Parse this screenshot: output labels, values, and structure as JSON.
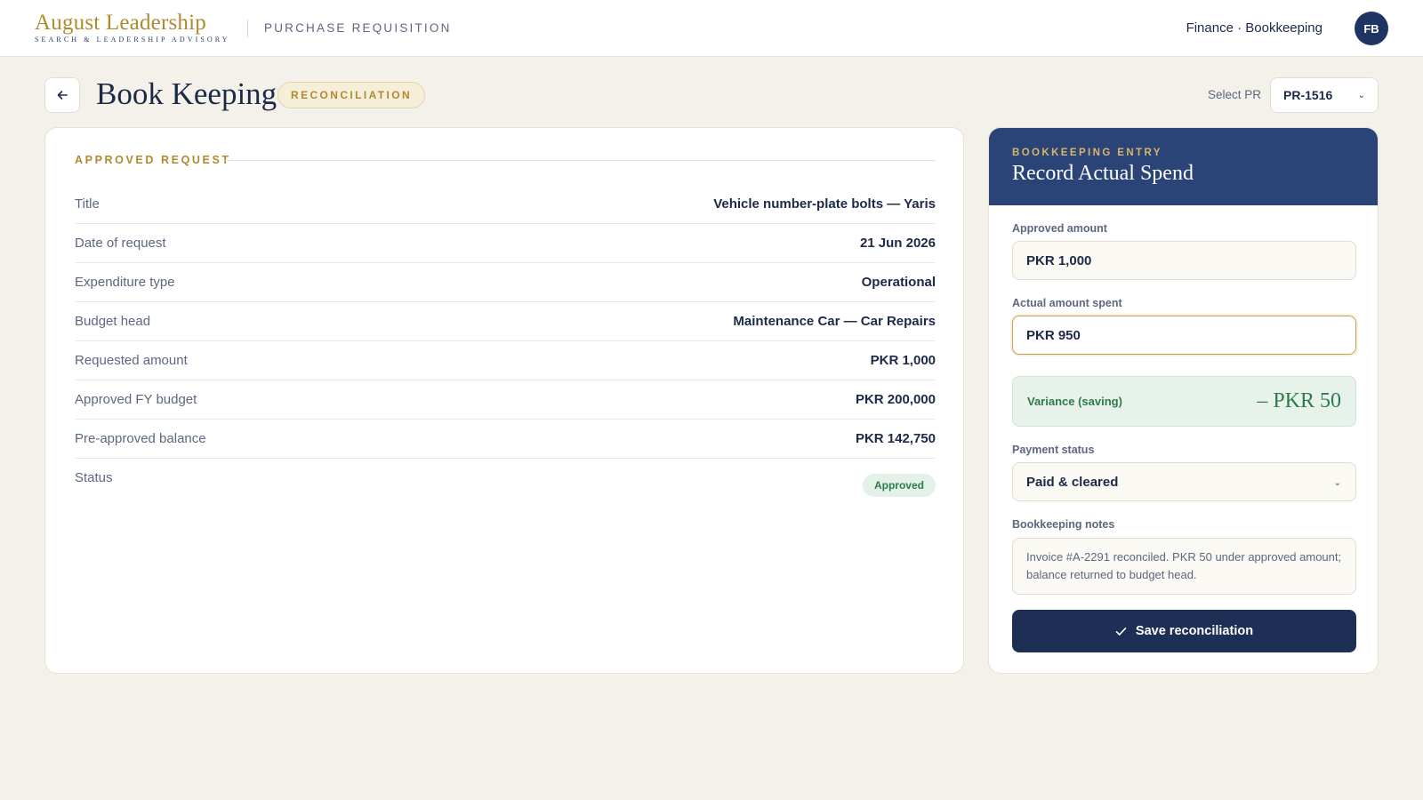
{
  "header": {
    "brand_name": "August Leadership",
    "brand_tagline": "SEARCH & LEADERSHIP ADVISORY",
    "module_title": "PURCHASE REQUISITION",
    "role_text": "Finance · Bookkeeping",
    "avatar_initials": "FB"
  },
  "page": {
    "title": "Book Keeping",
    "badge": "RECONCILIATION",
    "select_pr_label": "Select PR",
    "select_pr_value": "PR-1516"
  },
  "request": {
    "section_title": "APPROVED REQUEST",
    "rows": [
      {
        "label": "Title",
        "value": "Vehicle number-plate bolts — Yaris"
      },
      {
        "label": "Date of request",
        "value": "21 Jun 2026"
      },
      {
        "label": "Expenditure type",
        "value": "Operational"
      },
      {
        "label": "Budget head",
        "value": "Maintenance Car — Car Repairs"
      },
      {
        "label": "Requested amount",
        "value": "PKR 1,000"
      },
      {
        "label": "Approved FY budget",
        "value": "PKR 200,000"
      },
      {
        "label": "Pre-approved balance",
        "value": "PKR 142,750"
      }
    ],
    "status_label": "Status",
    "status_value": "Approved"
  },
  "entry": {
    "eyebrow": "BOOKKEEPING ENTRY",
    "title": "Record Actual Spend",
    "approved_label": "Approved amount",
    "approved_value": "PKR 1,000",
    "actual_label": "Actual amount spent",
    "actual_value": "PKR 950",
    "variance_label": "Variance (saving)",
    "variance_value": "– PKR 50",
    "payment_label": "Payment status",
    "payment_value": "Paid & cleared",
    "notes_label": "Bookkeeping notes",
    "notes_value": "Invoice #A-2291 reconciled. PKR 50 under approved amount; balance returned to budget head.",
    "save_label": "Save reconciliation"
  },
  "colors": {
    "brand_gold": "#b08a2e",
    "navy": "#1e2f56",
    "entry_header": "#2b4478",
    "success_green": "#2f7a4d",
    "page_bg": "#f4f1ea"
  },
  "icons": {
    "back": "arrow-left-icon",
    "chevron": "chevron-down-icon",
    "save": "check-icon"
  }
}
